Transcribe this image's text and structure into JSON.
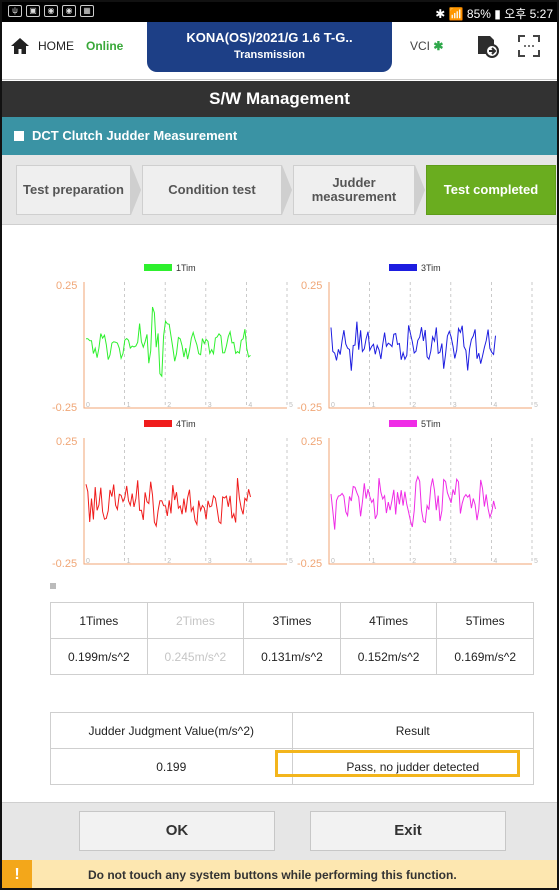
{
  "statusbar": {
    "right_text": "✱ 📶 85% ▮ 오후 5:27"
  },
  "header": {
    "home_label": "HOME",
    "online_label": "Online",
    "vehicle": "KONA(OS)/2021/G 1.6 T-G..",
    "system": "Transmission",
    "vci_label": "VCI"
  },
  "title": "S/W Management",
  "section": "DCT Clutch Judder Measurement",
  "steps": [
    {
      "label": "Test preparation"
    },
    {
      "label": "Condition test"
    },
    {
      "label": "Judder measurement"
    },
    {
      "label": "Test completed"
    }
  ],
  "charts": [
    {
      "name": "1Tim",
      "color": "#2ef02e"
    },
    {
      "name": "3Tim",
      "color": "#1d1de0"
    },
    {
      "name": "4Tim",
      "color": "#f01c1c"
    },
    {
      "name": "5Tim",
      "color": "#ef2ce6"
    }
  ],
  "chart_data": {
    "type": "line",
    "ylim": [
      -0.25,
      0.25
    ],
    "y_ticks": [
      "0.25",
      "-0.25"
    ],
    "x_ticks": [
      "0",
      "1",
      "2",
      "3",
      "4",
      "5"
    ],
    "series": [
      {
        "name": "1Tim"
      },
      {
        "name": "3Tim"
      },
      {
        "name": "4Tim"
      },
      {
        "name": "5Tim"
      }
    ]
  },
  "times_table": {
    "headers": [
      "1Times",
      "2Times",
      "3Times",
      "4Times",
      "5Times"
    ],
    "values": [
      "0.199m/s^2",
      "0.245m/s^2",
      "0.131m/s^2",
      "0.152m/s^2",
      "0.169m/s^2"
    ]
  },
  "judgment": {
    "header_value": "Judder Judgment Value(m/s^2)",
    "header_result": "Result",
    "value": "0.199",
    "result": "Pass, no judder detected"
  },
  "buttons": {
    "ok": "OK",
    "exit": "Exit"
  },
  "warning": {
    "icon": "!",
    "text": "Do not touch any system buttons while performing this function."
  }
}
